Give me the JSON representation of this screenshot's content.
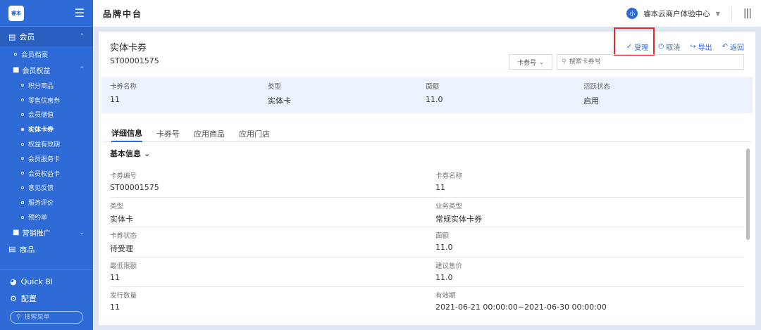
{
  "sidebar": {
    "logo_text": "睿本",
    "groups": [
      {
        "label": "会员",
        "icon": "member-card-icon"
      }
    ],
    "items": [
      {
        "label": "会员档案"
      }
    ],
    "sub_group": {
      "label": "会员权益"
    },
    "sub_items": [
      {
        "label": "积分商品"
      },
      {
        "label": "零售优惠券"
      },
      {
        "label": "会员储值"
      },
      {
        "label": "实体卡券"
      },
      {
        "label": "权益有效期"
      },
      {
        "label": "会员服务卡"
      },
      {
        "label": "会员权益卡"
      },
      {
        "label": "意见反馈"
      },
      {
        "label": "服务评价"
      },
      {
        "label": "预约单"
      }
    ],
    "marketing_group": {
      "label": "营销推广"
    },
    "cut_group": {
      "label": "商品"
    },
    "bottom": {
      "quickbi_label": "Quick BI",
      "config_label": "配置",
      "search_placeholder": "搜索菜单"
    }
  },
  "topbar": {
    "title": "品牌中台",
    "avatar_text": "小",
    "org_name": "睿本云商户体验中心"
  },
  "card": {
    "title": "实体卡券",
    "code": "ST00001575",
    "actions": {
      "accept": "受理",
      "cancel": "取消",
      "export": "导出",
      "back": "返回"
    },
    "search_select": "卡券号",
    "search_placeholder": "搜索卡券号",
    "summary": [
      {
        "label": "卡券名称",
        "value": "11"
      },
      {
        "label": "类型",
        "value": "实体卡"
      },
      {
        "label": "面额",
        "value": "11.0"
      },
      {
        "label": "活跃状态",
        "value": "启用"
      }
    ],
    "tabs": [
      {
        "label": "详细信息"
      },
      {
        "label": "卡券号"
      },
      {
        "label": "应用商品"
      },
      {
        "label": "应用门店"
      }
    ],
    "section_title": "基本信息",
    "fields": [
      {
        "label": "卡券编号",
        "value": "ST00001575"
      },
      {
        "label": "卡券名称",
        "value": "11"
      },
      {
        "label": "类型",
        "value": "实体卡"
      },
      {
        "label": "业务类型",
        "value": "常规实体卡券"
      },
      {
        "label": "卡券状态",
        "value": "待受理"
      },
      {
        "label": "面额",
        "value": "11.0"
      },
      {
        "label": "最低限额",
        "value": "11"
      },
      {
        "label": "建议售价",
        "value": "11.0"
      },
      {
        "label": "发行数量",
        "value": "11"
      },
      {
        "label": "有效期",
        "value": "2021-06-21 00:00:00~2021-06-30 00:00:00"
      }
    ]
  },
  "colors": {
    "primary": "#2f6bd6",
    "highlight": "#e12a2a"
  }
}
